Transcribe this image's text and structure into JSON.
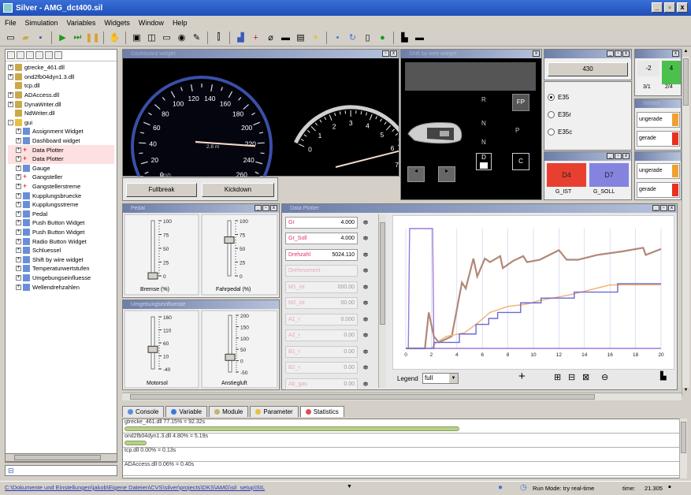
{
  "window": {
    "title": "Silver - AMG_dct400.sil",
    "min": "_",
    "max": "▫",
    "close": "x"
  },
  "menu": [
    "File",
    "Simulation",
    "Variables",
    "Widgets",
    "Window",
    "Help"
  ],
  "tree": {
    "items": [
      {
        "label": "gtrecke_461.dll",
        "icon": "dll",
        "level": 0,
        "exp": "+"
      },
      {
        "label": "ond2fb04dyn1.3.dll",
        "icon": "dll",
        "level": 0,
        "exp": "+"
      },
      {
        "label": "tcp.dll",
        "icon": "dll",
        "level": 0,
        "exp": ""
      },
      {
        "label": "ADAccess.dll",
        "icon": "dll",
        "level": 0,
        "exp": "+"
      },
      {
        "label": "DynaWriter.dll",
        "icon": "dll",
        "level": 0,
        "exp": "+"
      },
      {
        "label": "NdWriter.dll",
        "icon": "dll",
        "level": 0,
        "exp": ""
      },
      {
        "label": "gui",
        "icon": "folder",
        "level": 0,
        "exp": "-"
      },
      {
        "label": "Assignment Widget",
        "icon": "w",
        "level": 1,
        "exp": "+"
      },
      {
        "label": "Dashboard widget",
        "icon": "w",
        "level": 1,
        "exp": "+"
      },
      {
        "label": "Data Plotter",
        "icon": "r",
        "level": 1,
        "exp": "+"
      },
      {
        "label": "Data Plotter",
        "icon": "r",
        "level": 1,
        "exp": "+"
      },
      {
        "label": "Gauge",
        "icon": "w",
        "level": 1,
        "exp": "+"
      },
      {
        "label": "Gangsteller",
        "icon": "r",
        "level": 1,
        "exp": "+"
      },
      {
        "label": "Gangstellerstreme",
        "icon": "r",
        "level": 1,
        "exp": "+"
      },
      {
        "label": "Kupplungsbruecke",
        "icon": "w",
        "level": 1,
        "exp": "+"
      },
      {
        "label": "Kupplungsstreme",
        "icon": "w",
        "level": 1,
        "exp": "+"
      },
      {
        "label": "Pedal",
        "icon": "w",
        "level": 1,
        "exp": "+"
      },
      {
        "label": "Push Button Widget",
        "icon": "w",
        "level": 1,
        "exp": "+"
      },
      {
        "label": "Push Button Widget",
        "icon": "w",
        "level": 1,
        "exp": "+"
      },
      {
        "label": "Radio Button Widget",
        "icon": "w",
        "level": 1,
        "exp": "+"
      },
      {
        "label": "Schluessel",
        "icon": "w",
        "level": 1,
        "exp": "+"
      },
      {
        "label": "Shift by wire widget",
        "icon": "w",
        "level": 1,
        "exp": "+"
      },
      {
        "label": "Temperaturwertstufen",
        "icon": "w",
        "level": 1,
        "exp": "+"
      },
      {
        "label": "Umgebungseinfluesse",
        "icon": "w",
        "level": 1,
        "exp": "+"
      },
      {
        "label": "Wellendrehzahlen",
        "icon": "w",
        "level": 1,
        "exp": "+"
      }
    ]
  },
  "dashboard": {
    "title": "Dashboard widget",
    "speed_ticks": [
      "0",
      "20",
      "40",
      "60",
      "80",
      "100",
      "120",
      "140",
      "160",
      "180",
      "200",
      "220",
      "240",
      "260"
    ],
    "speed_unit": "km/h",
    "speed_readout": "2.8 m",
    "rpm_ticks": [
      "0",
      "1",
      "2",
      "3",
      "4",
      "5",
      "6",
      "7"
    ],
    "speed_value": 223,
    "rpm_value": 6.3
  },
  "buttons": {
    "fullbreak": "Fullbreak",
    "kickdown": "Kickdown"
  },
  "shifter": {
    "title": "Shift by wire widget",
    "p_label": "P",
    "r_label": "R",
    "n_label": "N",
    "d_label": "D",
    "c_label": "C",
    "fp_label": "FP",
    "n2_label": "N"
  },
  "assign": {
    "title": "Assignment",
    "value": "430"
  },
  "radio": {
    "options": [
      "E35",
      "E35r",
      "E35c"
    ],
    "selected": 0
  },
  "gears": {
    "labels": [
      "-2",
      "4"
    ],
    "sub": [
      "3/1",
      "2/4"
    ]
  },
  "gearbox": {
    "ist": "D4",
    "soll": "D7",
    "ist_label": "G_IST",
    "soll_label": "G_SOLL"
  },
  "wellen": {
    "title": "Wellen",
    "rows": [
      {
        "label": "ungerade"
      },
      {
        "label": "gerade"
      },
      {
        "label": "ungerade"
      },
      {
        "label": "gerade"
      }
    ]
  },
  "pedal": {
    "title": "Pedal",
    "brake_label": "Bremse (%)",
    "gas_label": "Fahrpedal (%)",
    "ticks": [
      "100",
      "75",
      "50",
      "25",
      "0"
    ],
    "brake_value": 0,
    "gas_value": 65
  },
  "umgebung": {
    "title": "Umgebungseinfluesse",
    "temp_label": "Motorsol",
    "slope_label": "Anstiegluft",
    "temp_ticks": [
      "160",
      "110",
      "60",
      "10",
      "-40"
    ],
    "slope_ticks": [
      "200",
      "150",
      "100",
      "50",
      "0",
      "-50"
    ],
    "temp_value": 35,
    "slope_value": 15
  },
  "plotter": {
    "title": "Data Plotter",
    "vars": [
      {
        "label": "Gr",
        "value": "4.000"
      },
      {
        "label": "Gr_Soll",
        "value": "4.000"
      },
      {
        "label": "Drehzahl",
        "value": "5024.110"
      },
      {
        "label": "Drehmoment",
        "value": ""
      },
      {
        "label": "M1_ist",
        "value": "000.00"
      },
      {
        "label": "M2_ist",
        "value": "00.00"
      },
      {
        "label": "A1_r",
        "value": "0.000"
      },
      {
        "label": "A2_r",
        "value": "0.00"
      },
      {
        "label": "B1_r",
        "value": "0.00"
      },
      {
        "label": "B2_r",
        "value": "0.00"
      },
      {
        "label": "Ab_gas",
        "value": "0.00"
      }
    ],
    "x_ticks": [
      "0",
      "2",
      "4",
      "6",
      "8",
      "10",
      "12",
      "14",
      "16",
      "18",
      "20"
    ],
    "legend_label": "Legend",
    "legend_value": "full"
  },
  "chart_data": {
    "type": "line",
    "x_range": [
      0,
      20
    ],
    "series": [
      {
        "color": "#9b7bd8",
        "values": [
          [
            0,
            0
          ],
          [
            0.2,
            0
          ],
          [
            0.3,
            1
          ],
          [
            2.1,
            1
          ],
          [
            2.2,
            0
          ],
          [
            20,
            0
          ]
        ]
      },
      {
        "color": "#b08878",
        "values": [
          [
            0,
            0
          ],
          [
            1.5,
            0
          ],
          [
            1.8,
            0.3
          ],
          [
            2.2,
            0.1
          ],
          [
            2.6,
            0.05
          ],
          [
            3.6,
            0.1
          ],
          [
            4.4,
            0.55
          ],
          [
            4.7,
            0.5
          ],
          [
            5.3,
            0.75
          ],
          [
            5.6,
            0.6
          ],
          [
            6.2,
            0.75
          ],
          [
            6.6,
            0.72
          ],
          [
            7.4,
            0.77
          ],
          [
            7.6,
            0.67
          ],
          [
            8.4,
            0.73
          ],
          [
            9.2,
            0.77
          ],
          [
            9.5,
            0.72
          ],
          [
            10.5,
            0.74
          ],
          [
            12,
            0.82
          ],
          [
            12.6,
            0.74
          ],
          [
            13.5,
            0.74
          ],
          [
            15,
            0.78
          ],
          [
            17,
            0.81
          ],
          [
            18.6,
            0.84
          ],
          [
            18.8,
            0.78
          ],
          [
            20,
            0.83
          ]
        ]
      },
      {
        "color": "#f0b070",
        "values": [
          [
            0,
            0
          ],
          [
            2,
            0
          ],
          [
            2.4,
            0.05
          ],
          [
            3.2,
            0.1
          ],
          [
            4.6,
            0.13
          ],
          [
            5.5,
            0.2
          ],
          [
            6.6,
            0.3
          ],
          [
            8,
            0.35
          ],
          [
            9.5,
            0.37
          ],
          [
            10.5,
            0.4
          ],
          [
            13,
            0.45
          ],
          [
            16,
            0.53
          ],
          [
            18.4,
            0.53
          ],
          [
            20,
            0.53
          ]
        ]
      },
      {
        "color": "#6a6ad8",
        "values": [
          [
            0,
            0
          ],
          [
            2.2,
            0
          ],
          [
            2.2,
            0.05
          ],
          [
            4.2,
            0.05
          ],
          [
            4.2,
            0.12
          ],
          [
            5.5,
            0.12
          ],
          [
            5.5,
            0.2
          ],
          [
            6.5,
            0.2
          ],
          [
            6.5,
            0.25
          ],
          [
            7.2,
            0.25
          ],
          [
            7.2,
            0.3
          ],
          [
            9,
            0.3
          ],
          [
            9,
            0.38
          ],
          [
            10.6,
            0.38
          ],
          [
            10.6,
            0.42
          ],
          [
            13.2,
            0.42
          ],
          [
            13.2,
            0.47
          ],
          [
            16.6,
            0.47
          ],
          [
            16.6,
            0.54
          ],
          [
            20,
            0.54
          ]
        ]
      }
    ]
  },
  "tabs": [
    {
      "label": "Console",
      "color": "#5b8fd8"
    },
    {
      "label": "Variable",
      "color": "#3a7ad8"
    },
    {
      "label": "Module",
      "color": "#c8b070"
    },
    {
      "label": "Parameter",
      "color": "#e8c040"
    },
    {
      "label": "Statistics",
      "color": "#d85050"
    }
  ],
  "output": [
    {
      "text": "gtrecke_461.dll 77.15% = 92.32s",
      "bar": 0.6
    },
    {
      "text": "ond2fb04dyn1.3.dll 4.80% = 5.19s",
      "bar": 0.04
    },
    {
      "text": "tcp.dll 0.00% = 0.13s",
      "bar": 0.0
    },
    {
      "text": "ADAccess.dll 0.06% = 0.40s",
      "bar": 0.0
    }
  ],
  "status": {
    "path": "C:\\Dokumente und Einstellungen\\jakob\\Eigene Dateien\\CVS\\silver\\projects\\DKS\\AMG\\sil_setup\\SIL",
    "mode": "Run Mode: try real-time",
    "time_label": "time:",
    "time_value": "21.305"
  }
}
